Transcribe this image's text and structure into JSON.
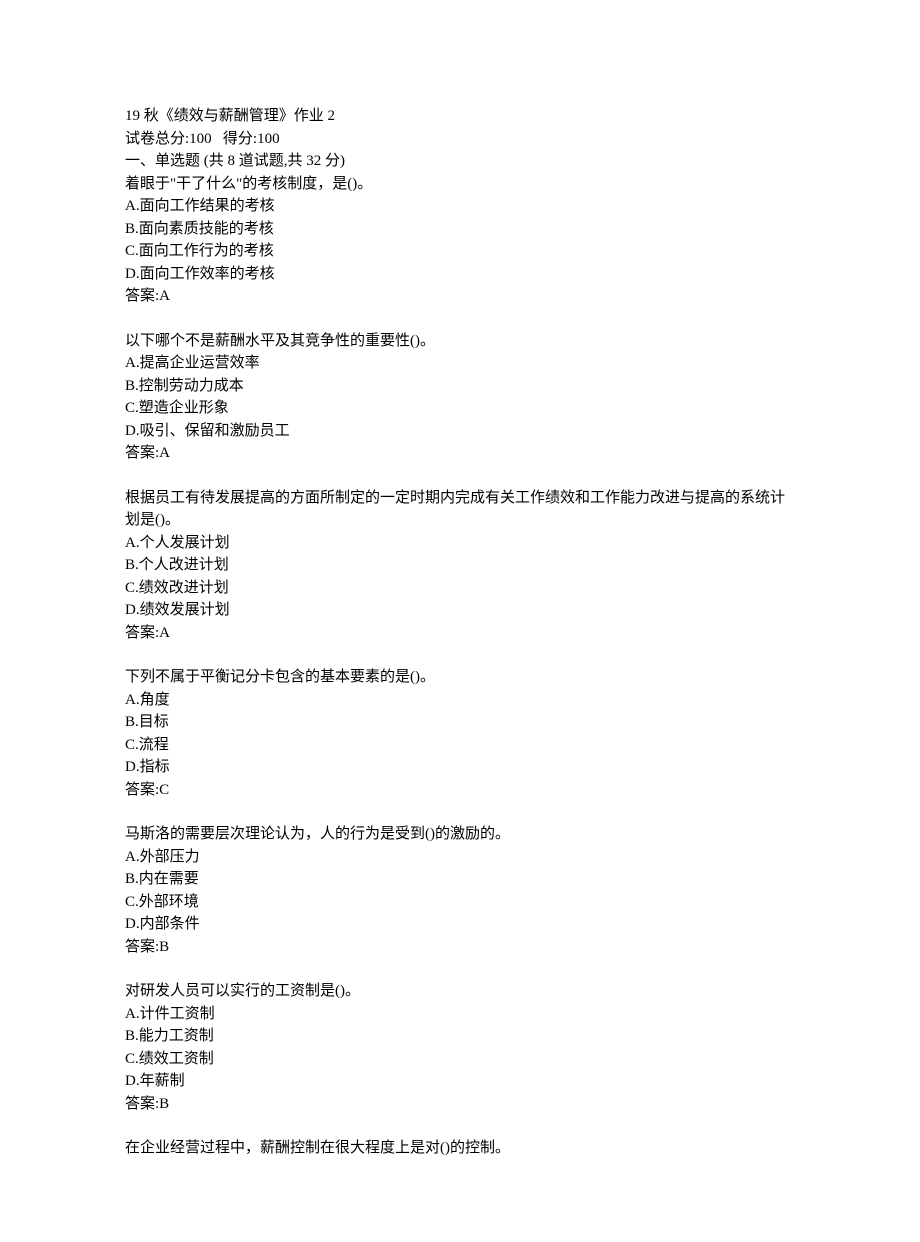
{
  "header": {
    "title": "19 秋《绩效与薪酬管理》作业 2",
    "score_line": "试卷总分:100   得分:100",
    "section_line": "一、单选题 (共 8 道试题,共 32 分)"
  },
  "questions": [
    {
      "stem": "着眼于\"干了什么\"的考核制度，是()。",
      "options": [
        "A.面向工作结果的考核",
        "B.面向素质技能的考核",
        "C.面向工作行为的考核",
        "D.面向工作效率的考核"
      ],
      "answer": "答案:A"
    },
    {
      "stem": "以下哪个不是薪酬水平及其竞争性的重要性()。",
      "options": [
        "A.提高企业运营效率",
        "B.控制劳动力成本",
        "C.塑造企业形象",
        "D.吸引、保留和激励员工"
      ],
      "answer": "答案:A"
    },
    {
      "stem": "根据员工有待发展提高的方面所制定的一定时期内完成有关工作绩效和工作能力改进与提高的系统计划是()。",
      "options": [
        "A.个人发展计划",
        "B.个人改进计划",
        "C.绩效改进计划",
        "D.绩效发展计划"
      ],
      "answer": "答案:A"
    },
    {
      "stem": "下列不属于平衡记分卡包含的基本要素的是()。",
      "options": [
        "A.角度",
        "B.目标",
        "C.流程",
        "D.指标"
      ],
      "answer": "答案:C"
    },
    {
      "stem": "马斯洛的需要层次理论认为，人的行为是受到()的激励的。",
      "options": [
        "A.外部压力",
        "B.内在需要",
        "C.外部环境",
        "D.内部条件"
      ],
      "answer": "答案:B"
    },
    {
      "stem": "对研发人员可以实行的工资制是()。",
      "options": [
        "A.计件工资制",
        "B.能力工资制",
        "C.绩效工资制",
        "D.年薪制"
      ],
      "answer": "答案:B"
    },
    {
      "stem": "在企业经营过程中，薪酬控制在很大程度上是对()的控制。",
      "options": [],
      "answer": ""
    }
  ]
}
